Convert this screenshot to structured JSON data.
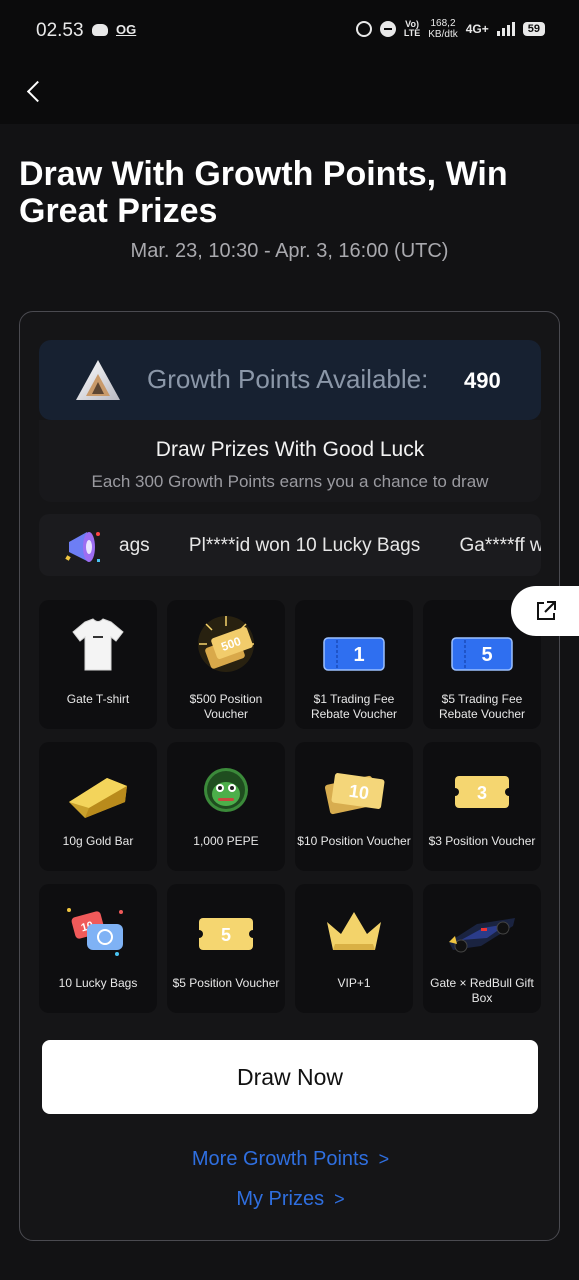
{
  "status_bar": {
    "time": "02.53",
    "og_label": "OG",
    "volte": "VoLTE",
    "speed_value": "168,2",
    "speed_unit": "KB/dtk",
    "network": "4G+",
    "battery": "59"
  },
  "header": {
    "back_icon": "chevron-left-icon"
  },
  "page": {
    "title": "Draw With Growth Points, Win Great Prizes",
    "date_range": "Mar. 23, 10:30 - Apr. 3, 16:00 (UTC)"
  },
  "points": {
    "label": "Growth Points Available:",
    "value": "490"
  },
  "draw_info": {
    "title": "Draw Prizes With Good Luck",
    "description": "Each 300 Growth Points earns you a chance to draw"
  },
  "ticker": {
    "items": [
      "ags",
      "Pl****id won 10 Lucky Bags",
      "Ga****ff w"
    ]
  },
  "prizes": [
    {
      "label": "Gate T-shirt",
      "icon": "tshirt-icon"
    },
    {
      "label": "$500 Position Voucher",
      "icon": "voucher-500-icon",
      "badge": "500"
    },
    {
      "label": "$1 Trading Fee Rebate Voucher",
      "icon": "rebate-voucher-icon",
      "badge": "1"
    },
    {
      "label": "$5 Trading Fee Rebate Voucher",
      "icon": "rebate-voucher-icon",
      "badge": "5"
    },
    {
      "label": "10g Gold Bar",
      "icon": "gold-bar-icon"
    },
    {
      "label": "1,000 PEPE",
      "icon": "pepe-coin-icon"
    },
    {
      "label": "$10 Position Voucher",
      "icon": "voucher-10-icon",
      "badge": "10"
    },
    {
      "label": "$3 Position Voucher",
      "icon": "voucher-3-icon",
      "badge": "3"
    },
    {
      "label": "10 Lucky Bags",
      "icon": "lucky-bag-icon",
      "badge": "10"
    },
    {
      "label": "$5 Position Voucher",
      "icon": "voucher-5-icon",
      "badge": "5"
    },
    {
      "label": "VIP+1",
      "icon": "crown-icon"
    },
    {
      "label": "Gate × RedBull Gift Box",
      "icon": "race-car-icon"
    }
  ],
  "actions": {
    "draw_now": "Draw Now",
    "more_points": "More Growth Points",
    "my_prizes": "My Prizes",
    "chevron": ">"
  },
  "colors": {
    "background": "#121214",
    "accent_link": "#2f6fe0",
    "points_box": "#172131",
    "gold": "#f2cc4f",
    "rebate_blue": "#2f6ff0"
  }
}
